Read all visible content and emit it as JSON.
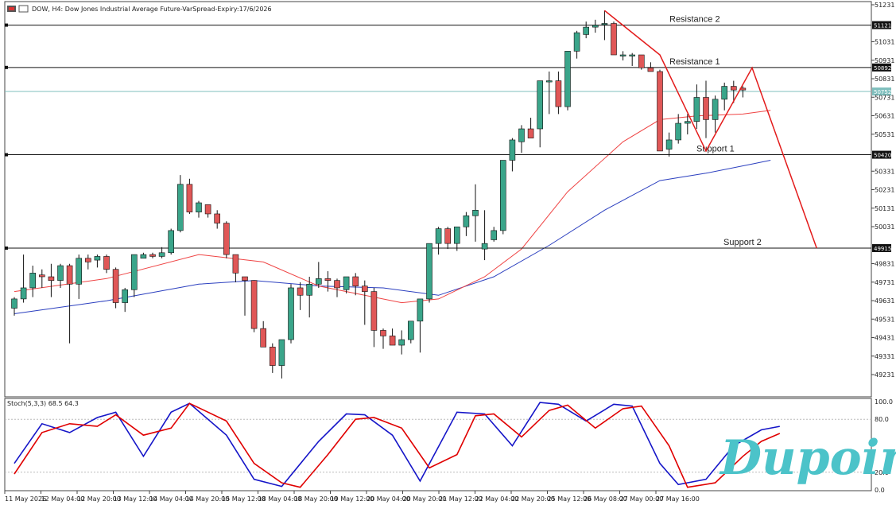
{
  "header": {
    "title": "DOW, H4:  Dow Jones Industrial Average Future-VarSpread-Expiry:17/6/2026"
  },
  "chart_data": {
    "type": "candlestick",
    "symbol": "DOW",
    "timeframe": "H4",
    "price_ticks": [
      "51231",
      "51031",
      "50931",
      "50831",
      "50731",
      "50631",
      "50531",
      "50331",
      "50231",
      "50131",
      "50031",
      "49831",
      "49731",
      "49631",
      "49531",
      "49431",
      "49331",
      "49231"
    ],
    "time_ticks": [
      "11 May 2026",
      "12 May 04:00",
      "12 May 20:00",
      "13 May 12:00",
      "14 May 04:00",
      "14 May 20:00",
      "15 May 12:00",
      "18 May 04:00",
      "18 May 20:00",
      "19 May 12:00",
      "20 May 04:00",
      "20 May 20:00",
      "21 May 12:00",
      "22 May 04:00",
      "22 May 20:00",
      "25 May 12:00",
      "26 May 08:00",
      "27 May 00:00",
      "27 May 16:00"
    ],
    "candles": [
      [
        49590,
        49650,
        49550,
        49640
      ],
      [
        49640,
        49880,
        49620,
        49700
      ],
      [
        49700,
        49820,
        49650,
        49780
      ],
      [
        49770,
        49800,
        49700,
        49760
      ],
      [
        49760,
        49830,
        49650,
        49740
      ],
      [
        49740,
        49830,
        49700,
        49820
      ],
      [
        49820,
        49830,
        49400,
        49720
      ],
      [
        49720,
        49880,
        49640,
        49860
      ],
      [
        49860,
        49880,
        49800,
        49840
      ],
      [
        49850,
        49880,
        49810,
        49870
      ],
      [
        49870,
        49880,
        49780,
        49800
      ],
      [
        49800,
        49810,
        49590,
        49620
      ],
      [
        49620,
        49700,
        49570,
        49690
      ],
      [
        49690,
        49880,
        49650,
        49880
      ],
      [
        49860,
        49890,
        49860,
        49880
      ],
      [
        49880,
        49890,
        49860,
        49870
      ],
      [
        49870,
        49920,
        49860,
        49890
      ],
      [
        49890,
        50020,
        49880,
        50010
      ],
      [
        50010,
        50310,
        50000,
        50260
      ],
      [
        50260,
        50290,
        50100,
        50110
      ],
      [
        50110,
        50170,
        50080,
        50160
      ],
      [
        50150,
        50150,
        50080,
        50100
      ],
      [
        50100,
        50120,
        50020,
        50050
      ],
      [
        50050,
        50060,
        49860,
        49880
      ],
      [
        49880,
        49880,
        49730,
        49780
      ],
      [
        49760,
        49760,
        49550,
        49740
      ],
      [
        49740,
        49740,
        49460,
        49480
      ],
      [
        49480,
        49520,
        49400,
        49380
      ],
      [
        49380,
        49400,
        49240,
        49280
      ],
      [
        49280,
        49400,
        49210,
        49420
      ],
      [
        49420,
        49720,
        49400,
        49700
      ],
      [
        49700,
        49730,
        49580,
        49660
      ],
      [
        49660,
        49760,
        49540,
        49720
      ],
      [
        49720,
        49840,
        49700,
        49750
      ],
      [
        49750,
        49790,
        49680,
        49740
      ],
      [
        49740,
        49750,
        49650,
        49700
      ],
      [
        49690,
        49760,
        49670,
        49760
      ],
      [
        49760,
        49780,
        49660,
        49710
      ],
      [
        49710,
        49740,
        49500,
        49680
      ],
      [
        49680,
        49700,
        49380,
        49470
      ],
      [
        49470,
        49480,
        49370,
        49440
      ],
      [
        49440,
        49480,
        49390,
        49390
      ],
      [
        49390,
        49470,
        49340,
        49420
      ],
      [
        49420,
        49510,
        49400,
        49520
      ],
      [
        49520,
        49560,
        49350,
        49640
      ],
      [
        49640,
        49920,
        49620,
        49940
      ],
      [
        49940,
        50030,
        49880,
        50020
      ],
      [
        50020,
        50030,
        49910,
        49940
      ],
      [
        49940,
        50030,
        49900,
        50030
      ],
      [
        50030,
        50110,
        49980,
        50090
      ],
      [
        50090,
        50260,
        49950,
        50120
      ],
      [
        49910,
        50120,
        49850,
        49940
      ],
      [
        49960,
        50030,
        49950,
        50010
      ],
      [
        50010,
        50390,
        49990,
        50390
      ],
      [
        50390,
        50510,
        50330,
        50500
      ],
      [
        50490,
        50580,
        50430,
        50560
      ],
      [
        50560,
        50620,
        50520,
        50510
      ],
      [
        50560,
        50820,
        50460,
        50820
      ],
      [
        50820,
        50870,
        50640,
        50820
      ],
      [
        50820,
        50870,
        50640,
        50680
      ],
      [
        50680,
        50980,
        50660,
        50980
      ],
      [
        50980,
        51090,
        50940,
        51080
      ],
      [
        51070,
        51140,
        51050,
        51110
      ],
      [
        51110,
        51150,
        51080,
        51120
      ],
      [
        51130,
        51200,
        51040,
        51130
      ],
      [
        51130,
        51140,
        50960,
        50960
      ],
      [
        50960,
        50980,
        50930,
        50960
      ],
      [
        50960,
        50970,
        50900,
        50960
      ],
      [
        50960,
        50960,
        50880,
        50890
      ],
      [
        50890,
        50920,
        50870,
        50870
      ],
      [
        50870,
        50880,
        50440,
        50440
      ],
      [
        50450,
        50540,
        50410,
        50500
      ],
      [
        50500,
        50640,
        50480,
        50590
      ],
      [
        50590,
        50640,
        50530,
        50600
      ],
      [
        50600,
        50800,
        50560,
        50730
      ],
      [
        50730,
        50820,
        50510,
        50610
      ],
      [
        50610,
        50740,
        50540,
        50720
      ],
      [
        50720,
        50810,
        50660,
        50790
      ],
      [
        50790,
        50820,
        50700,
        50770
      ],
      [
        50780,
        50790,
        50730,
        50770
      ]
    ],
    "levels": [
      {
        "name": "Resistance 2",
        "price": 51121,
        "badge": "51121"
      },
      {
        "name": "Resistance 1",
        "price": 50892,
        "badge": "50892"
      },
      {
        "name": "Support 1",
        "price": 50420,
        "badge": "50420"
      },
      {
        "name": "Support 2",
        "price": 49915,
        "badge": "49915"
      }
    ],
    "current_price": {
      "price": 50762,
      "badge": "50752"
    },
    "pattern_lines": [
      {
        "points": [
          [
            64,
            51200
          ],
          [
            70,
            50960
          ],
          [
            75,
            50440
          ],
          [
            80,
            50890
          ],
          [
            87,
            49915
          ]
        ]
      }
    ],
    "ma_fast": [
      [
        0,
        49680
      ],
      [
        10,
        49750
      ],
      [
        20,
        49880
      ],
      [
        27,
        49840
      ],
      [
        33,
        49710
      ],
      [
        42,
        49620
      ],
      [
        46,
        49640
      ],
      [
        51,
        49760
      ],
      [
        55,
        49910
      ],
      [
        60,
        50220
      ],
      [
        66,
        50490
      ],
      [
        70,
        50610
      ],
      [
        74,
        50630
      ],
      [
        79,
        50640
      ],
      [
        82,
        50660
      ]
    ],
    "ma_slow": [
      [
        0,
        49560
      ],
      [
        10,
        49630
      ],
      [
        20,
        49720
      ],
      [
        26,
        49740
      ],
      [
        33,
        49710
      ],
      [
        40,
        49700
      ],
      [
        46,
        49660
      ],
      [
        52,
        49760
      ],
      [
        58,
        49930
      ],
      [
        64,
        50120
      ],
      [
        70,
        50280
      ],
      [
        75,
        50320
      ],
      [
        80,
        50370
      ],
      [
        82,
        50390
      ]
    ],
    "colors": {
      "bull": "#3aa58a",
      "bear": "#e05757",
      "level_line": "#111111",
      "current_line": "#7fbfbd",
      "pattern": "#e31b1b",
      "ma_fast": "#ef4444",
      "ma_slow": "#2b3fbf",
      "stoch_main": "#1515c8",
      "stoch_signal": "#e00000",
      "logo": "#4cc3c9"
    },
    "stochastic": {
      "label": "Stoch(5,3,3) 68.5 64.3",
      "ticks": [
        "100.0",
        "80.0",
        "20.0",
        "0.0"
      ],
      "main": [
        [
          0,
          30
        ],
        [
          3,
          75
        ],
        [
          6,
          65
        ],
        [
          9,
          82
        ],
        [
          11,
          88
        ],
        [
          14,
          38
        ],
        [
          17,
          88
        ],
        [
          19,
          98
        ],
        [
          23,
          62
        ],
        [
          26,
          12
        ],
        [
          29,
          4
        ],
        [
          33,
          55
        ],
        [
          36,
          86
        ],
        [
          38,
          85
        ],
        [
          41,
          62
        ],
        [
          44,
          10
        ],
        [
          48,
          88
        ],
        [
          51,
          86
        ],
        [
          54,
          50
        ],
        [
          57,
          99
        ],
        [
          59,
          97
        ],
        [
          62,
          78
        ],
        [
          65,
          97
        ],
        [
          67,
          95
        ],
        [
          70,
          30
        ],
        [
          72,
          6
        ],
        [
          75,
          12
        ],
        [
          78,
          50
        ],
        [
          81,
          68
        ],
        [
          83,
          72
        ]
      ],
      "signal": [
        [
          0,
          18
        ],
        [
          3,
          65
        ],
        [
          6,
          75
        ],
        [
          9,
          72
        ],
        [
          11,
          85
        ],
        [
          14,
          62
        ],
        [
          17,
          70
        ],
        [
          19,
          98
        ],
        [
          23,
          78
        ],
        [
          26,
          30
        ],
        [
          29,
          8
        ],
        [
          31,
          3
        ],
        [
          34,
          40
        ],
        [
          37,
          80
        ],
        [
          39,
          82
        ],
        [
          42,
          70
        ],
        [
          45,
          25
        ],
        [
          48,
          40
        ],
        [
          50,
          84
        ],
        [
          52,
          86
        ],
        [
          55,
          60
        ],
        [
          58,
          90
        ],
        [
          60,
          96
        ],
        [
          63,
          70
        ],
        [
          66,
          92
        ],
        [
          68,
          95
        ],
        [
          71,
          50
        ],
        [
          73,
          3
        ],
        [
          76,
          8
        ],
        [
          79,
          38
        ],
        [
          81,
          55
        ],
        [
          83,
          64
        ]
      ]
    }
  },
  "logo": {
    "text": "Dupoin"
  }
}
